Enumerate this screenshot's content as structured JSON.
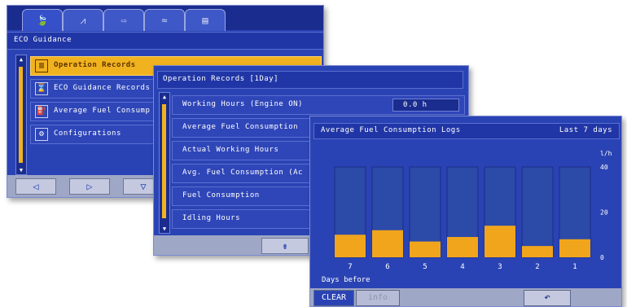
{
  "screen1": {
    "tabs": [
      {
        "icon": "eco-leaf-icon",
        "glyph": "🍃"
      },
      {
        "icon": "machine-icon",
        "glyph": "⩘"
      },
      {
        "icon": "arrows-icon",
        "glyph": "⇨"
      },
      {
        "icon": "wrench-icon",
        "glyph": "≈"
      },
      {
        "icon": "document-icon",
        "glyph": "▤"
      }
    ],
    "title": "ECO Guidance",
    "items": [
      {
        "label": "Operation Records",
        "icon": "records-icon",
        "glyph": "▥"
      },
      {
        "label": "ECO Guidance Records",
        "icon": "guidance-records-icon",
        "glyph": "⌛"
      },
      {
        "label": "Average Fuel Consump",
        "icon": "fuel-icon",
        "glyph": "⛽"
      },
      {
        "label": "Configurations",
        "icon": "config-icon",
        "glyph": "⚙"
      }
    ],
    "nav": [
      {
        "name": "left-button",
        "glyph": "◁"
      },
      {
        "name": "right-button",
        "glyph": "▷"
      },
      {
        "name": "down-button",
        "glyph": "▽"
      }
    ]
  },
  "screen2": {
    "title": "Operation Records  [1Day]",
    "rows": [
      {
        "label": "Working Hours (Engine ON)",
        "value": "0.0  h"
      },
      {
        "label": "Average Fuel Consumption",
        "value": ""
      },
      {
        "label": "Actual Working Hours",
        "value": ""
      },
      {
        "label": "Avg. Fuel Consumption (Ac",
        "value": ""
      },
      {
        "label": "Fuel Consumption",
        "value": ""
      },
      {
        "label": "Idling Hours",
        "value": ""
      }
    ],
    "bottom_button_glyph": "⇟"
  },
  "screen3": {
    "title": "Average Fuel Consumption Logs",
    "range": "Last 7 days",
    "clear_label": "CLEAR",
    "disabled_label": "info",
    "back_glyph": "↶"
  },
  "chart_data": {
    "type": "bar",
    "title": "Average Fuel Consumption Logs",
    "xlabel": "Days before",
    "ylabel": "",
    "unit": "l/h",
    "categories": [
      "7",
      "6",
      "5",
      "4",
      "3",
      "2",
      "1"
    ],
    "values": [
      10,
      12,
      7,
      9,
      14,
      5,
      8
    ],
    "ylim": [
      0,
      40
    ],
    "yticks": [
      {
        "value": 0,
        "label": "0"
      },
      {
        "value": 20,
        "label": "20"
      },
      {
        "value": 40,
        "label": "40"
      }
    ],
    "colors": {
      "bar_fill": "#f1a51d",
      "bar_bg": "#2c4aa8",
      "border": "#1b2c86"
    }
  }
}
